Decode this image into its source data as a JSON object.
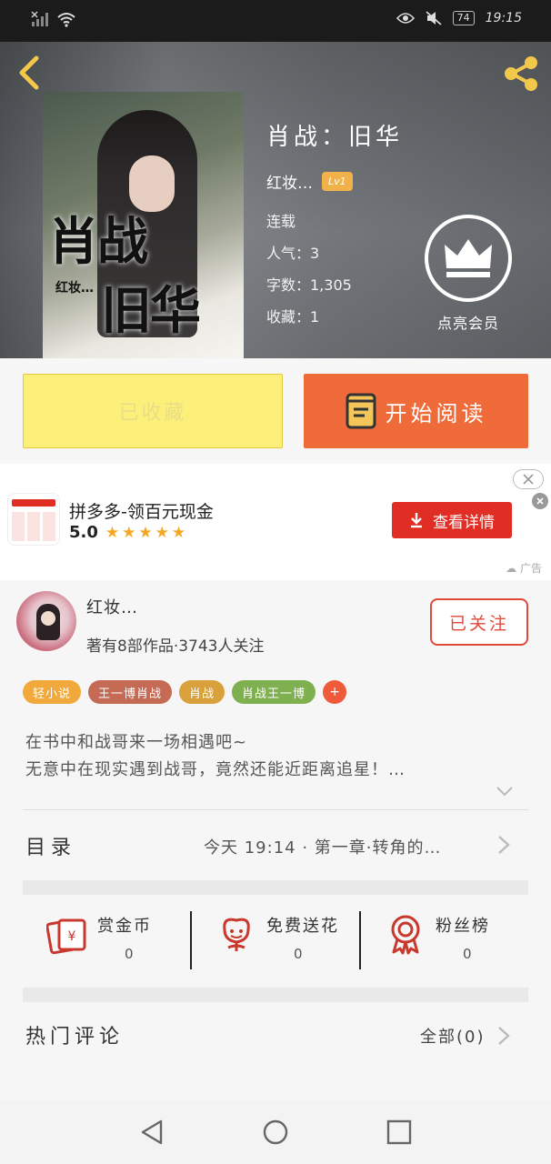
{
  "status_bar": {
    "battery": "74",
    "time": "19:15"
  },
  "book": {
    "title": "肖战：旧华",
    "author": "红妆…",
    "level_badge": "Lv1",
    "status": "连载",
    "popularity": "人气：3",
    "word_count": "字数：1,305",
    "favorites": "收藏：1",
    "cover_text_1": "肖战",
    "cover_text_2": "旧华",
    "cover_author": "红妆…"
  },
  "vip": {
    "label": "点亮会员"
  },
  "actions": {
    "collected_label": "已收藏",
    "read_label": "开始阅读"
  },
  "ad": {
    "title": "拼多多-领百元现金",
    "rating": "5.0",
    "stars": "★★★★★",
    "cta": "查看详情",
    "tag": "广告",
    "colors": {
      "brand": "#e02e24"
    }
  },
  "author": {
    "name": "红妆…",
    "stats": "著有8部作品·3743人关注",
    "follow_label": "已关注"
  },
  "tags": [
    {
      "label": "轻小说",
      "color": "#f0a93a"
    },
    {
      "label": "王一博肖战",
      "color": "#c56a55"
    },
    {
      "label": "肖战",
      "color": "#d9a13c"
    },
    {
      "label": "肖战王一博",
      "color": "#7fb04f"
    }
  ],
  "tag_more": "+",
  "synopsis": {
    "line1": "在书中和战哥来一场相遇吧~",
    "line2": "无意中在现实遇到战哥，竟然还能近距离追星！…"
  },
  "toc": {
    "label": "目录",
    "latest": "今天 19:14 · 第一章·转角的…"
  },
  "stats": [
    {
      "label": "赏金币",
      "value": "0",
      "icon": "red-envelope-icon"
    },
    {
      "label": "免费送花",
      "value": "0",
      "icon": "flower-icon"
    },
    {
      "label": "粉丝榜",
      "value": "0",
      "icon": "medal-icon"
    }
  ],
  "comments": {
    "label": "热门评论",
    "all": "全部(0)"
  },
  "icons": [
    "back-arrow-icon",
    "share-icon",
    "crown-icon",
    "book-icon",
    "download-icon",
    "chevron-down-icon",
    "chevron-right-icon",
    "nav-back-icon",
    "nav-home-icon",
    "nav-recent-icon"
  ],
  "colors": {
    "accent": "#ef6b3a",
    "collected_bg": "#fdf07a",
    "follow": "#e0483a",
    "gold": "#f2b24a"
  }
}
